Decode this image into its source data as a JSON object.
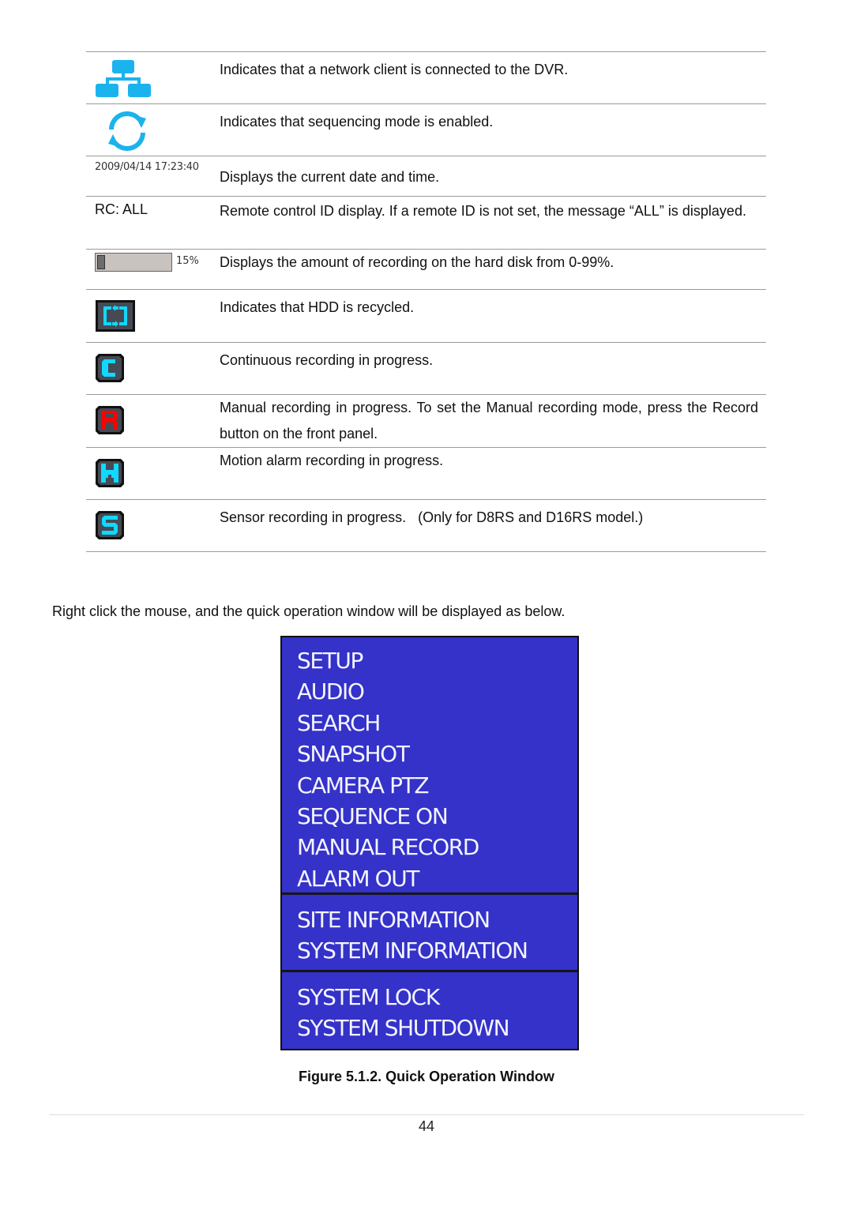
{
  "table": {
    "rows": [
      {
        "icon": "network-client-icon",
        "description": "Indicates that a network client is connected to the DVR."
      },
      {
        "icon": "sequence-icon",
        "description": "Indicates that sequencing mode is enabled."
      },
      {
        "icon_text": "2009/04/14 17:23:40",
        "description": "Displays the current date and time."
      },
      {
        "icon_text": "RC: ALL",
        "description": "Remote control ID display. If a remote ID is not set, the message “ALL” is displayed."
      },
      {
        "icon": "hdd-usage-bar",
        "hdd_percent": 15,
        "icon_text": "15%",
        "description": "Displays the amount of recording on the hard disk from 0-99%."
      },
      {
        "icon": "hdd-recycle-icon",
        "description": "Indicates that HDD is recycled."
      },
      {
        "icon": "continuous-recording-icon",
        "icon_letter": "C",
        "description": "Continuous recording in progress."
      },
      {
        "icon": "manual-recording-icon",
        "icon_letter": "R",
        "description": "Manual recording in progress. To set the Manual recording mode, press the Record button on the front panel."
      },
      {
        "icon": "motion-recording-icon",
        "icon_letter": "M",
        "description": "Motion alarm recording in progress."
      },
      {
        "icon": "sensor-recording-icon",
        "icon_letter": "S",
        "description": "Sensor recording in progress.   (Only for D8RS and D16RS model.)"
      }
    ]
  },
  "colors": {
    "icon_blue": "#1ab3ee",
    "badge_cyan": "#10d8ff",
    "badge_red": "#ff0000",
    "badge_bg": "#454a55",
    "menu_bg": "#3432c8",
    "menu_text": "#f4f4ff"
  },
  "intro_text": "Right click the mouse, and the quick operation window will be displayed as below.",
  "quick_menu": {
    "sections": [
      [
        "SETUP",
        "AUDIO",
        "SEARCH",
        "SNAPSHOT",
        "CAMERA PTZ",
        "SEQUENCE ON",
        "MANUAL RECORD",
        "ALARM OUT"
      ],
      [
        "SITE INFORMATION",
        "SYSTEM INFORMATION"
      ],
      [
        "SYSTEM LOCK",
        "SYSTEM SHUTDOWN"
      ]
    ]
  },
  "caption": "Figure 5.1.2. Quick Operation Window",
  "page_number": "44"
}
